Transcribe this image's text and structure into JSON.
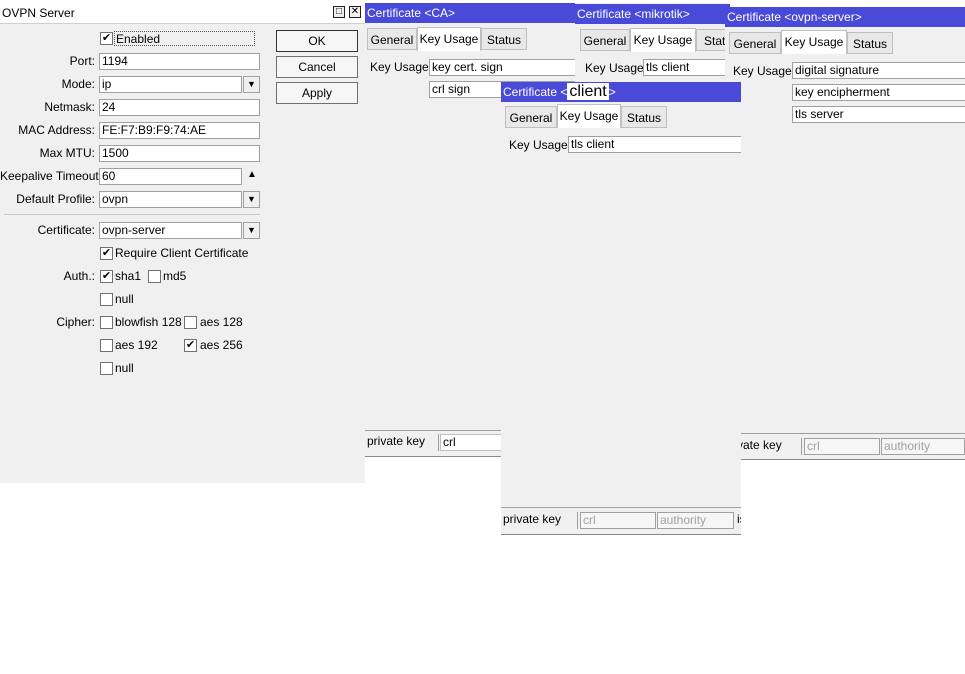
{
  "ovpn": {
    "title": "OVPN Server",
    "enabled_label": "Enabled",
    "port_label": "Port:",
    "port": "1194",
    "mode_label": "Mode:",
    "mode": "ip",
    "netmask_label": "Netmask:",
    "netmask": "24",
    "mac_label": "MAC Address:",
    "mac": "FE:F7:B9:F9:74:AE",
    "mtu_label": "Max MTU:",
    "mtu": "1500",
    "keepalive_label": "Keepalive Timeout:",
    "keepalive": "60",
    "profile_label": "Default Profile:",
    "profile": "ovpn",
    "cert_label": "Certificate:",
    "cert": "ovpn-server",
    "require_label": "Require Client Certificate",
    "auth_label": "Auth.:",
    "sha1": "sha1",
    "md5": "md5",
    "null": "null",
    "cipher_label": "Cipher:",
    "blowfish": "blowfish 128",
    "aes128": "aes 128",
    "aes192": "aes 192",
    "aes256": "aes 256",
    "cipher_null": "null",
    "ok": "OK",
    "cancel": "Cancel",
    "apply": "Apply"
  },
  "tabs": {
    "general": "General",
    "key_usage": "Key Usage",
    "status": "Status",
    "status_cut": "Statu"
  },
  "key_usage_label": "Key Usage:",
  "ca": {
    "title": "Certificate <CA>",
    "usage": [
      "key cert. sign",
      "crl sign"
    ],
    "status": [
      "private key",
      "crl"
    ]
  },
  "mikrotik": {
    "title": "Certificate <mikrotik>",
    "usage": [
      "tls client"
    ]
  },
  "client": {
    "title_prefix": "Certificate <",
    "title_overlay": "client",
    "title_suffix": ">",
    "usage": [
      "tls client"
    ],
    "status": [
      "private key",
      "crl",
      "authority",
      "is"
    ]
  },
  "ovpnserver": {
    "title": "Certificate <ovpn-server>",
    "usage": [
      "digital signature",
      "key encipherment",
      "tls server"
    ],
    "status": [
      "vate key",
      "crl",
      "authority"
    ]
  },
  "colors": {
    "titlebar": "#4a4ad8",
    "window": "#f0f0f0"
  }
}
